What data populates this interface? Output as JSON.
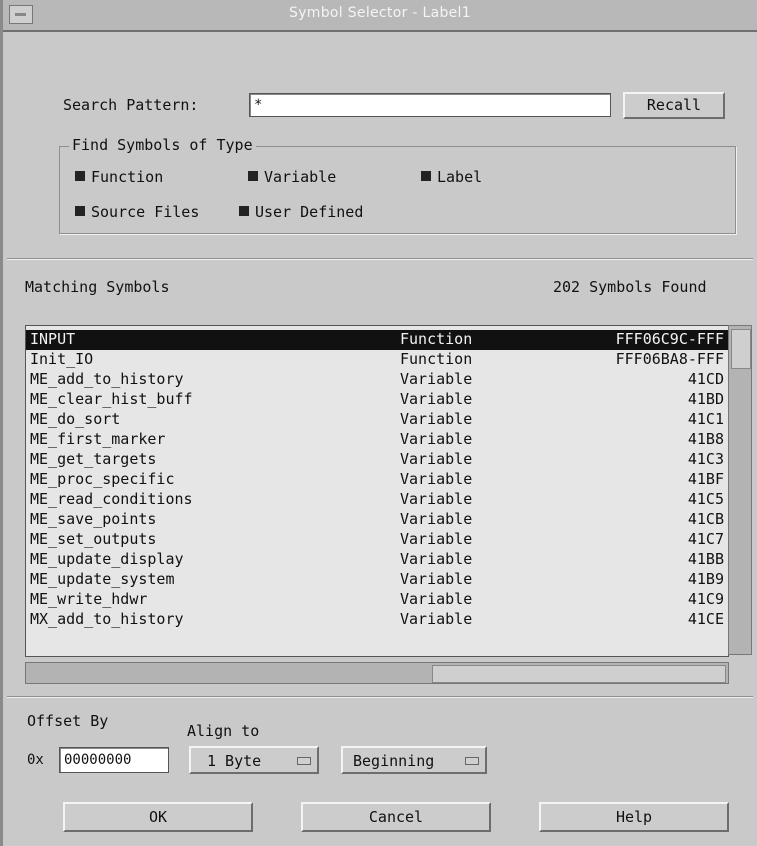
{
  "window": {
    "title": "Symbol Selector - Label1"
  },
  "search": {
    "label": "Search Pattern:",
    "value": "*",
    "recall_label": "Recall"
  },
  "find_group": {
    "title": "Find Symbols of Type",
    "options": [
      {
        "label": "Function",
        "checked": true
      },
      {
        "label": "Variable",
        "checked": true
      },
      {
        "label": "Label",
        "checked": true
      },
      {
        "label": "Source Files",
        "checked": true
      },
      {
        "label": "User Defined",
        "checked": true
      }
    ]
  },
  "results": {
    "label": "Matching Symbols",
    "count_text": "202 Symbols Found",
    "rows": [
      {
        "name": "INPUT",
        "type": "Function",
        "address": "FFF06C9C-FFF",
        "selected": true
      },
      {
        "name": "Init_IO",
        "type": "Function",
        "address": "FFF06BA8-FFF"
      },
      {
        "name": "ME_add_to_history",
        "type": "Variable",
        "address": "41CD"
      },
      {
        "name": "ME_clear_hist_buff",
        "type": "Variable",
        "address": "41BD"
      },
      {
        "name": "ME_do_sort",
        "type": "Variable",
        "address": "41C1"
      },
      {
        "name": "ME_first_marker",
        "type": "Variable",
        "address": "41B8"
      },
      {
        "name": "ME_get_targets",
        "type": "Variable",
        "address": "41C3"
      },
      {
        "name": "ME_proc_specific",
        "type": "Variable",
        "address": "41BF"
      },
      {
        "name": "ME_read_conditions",
        "type": "Variable",
        "address": "41C5"
      },
      {
        "name": "ME_save_points",
        "type": "Variable",
        "address": "41CB"
      },
      {
        "name": "ME_set_outputs",
        "type": "Variable",
        "address": "41C7"
      },
      {
        "name": "ME_update_display",
        "type": "Variable",
        "address": "41BB"
      },
      {
        "name": "ME_update_system",
        "type": "Variable",
        "address": "41B9"
      },
      {
        "name": "ME_write_hdwr",
        "type": "Variable",
        "address": "41C9"
      },
      {
        "name": "MX_add_to_history",
        "type": "Variable",
        "address": "41CE"
      }
    ]
  },
  "offset": {
    "label": "Offset By",
    "prefix": "0x",
    "value": "00000000"
  },
  "align": {
    "label": "Align to",
    "value": "1 Byte",
    "position": "Beginning"
  },
  "buttons": {
    "ok": "OK",
    "cancel": "Cancel",
    "help": "Help"
  }
}
